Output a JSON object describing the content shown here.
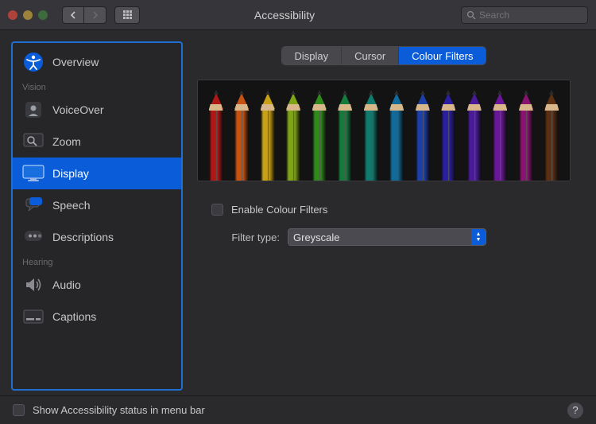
{
  "window": {
    "title": "Accessibility",
    "search_placeholder": "Search"
  },
  "sidebar": {
    "sections": [
      {
        "label": "",
        "items": [
          {
            "id": "overview",
            "label": "Overview",
            "icon": "accessibility-icon",
            "selected": false
          }
        ]
      },
      {
        "label": "Vision",
        "items": [
          {
            "id": "voiceover",
            "label": "VoiceOver",
            "icon": "voiceover-icon",
            "selected": false
          },
          {
            "id": "zoom",
            "label": "Zoom",
            "icon": "zoom-icon",
            "selected": false
          },
          {
            "id": "display",
            "label": "Display",
            "icon": "display-icon",
            "selected": true
          },
          {
            "id": "speech",
            "label": "Speech",
            "icon": "speech-icon",
            "selected": false
          },
          {
            "id": "descriptions",
            "label": "Descriptions",
            "icon": "descriptions-icon",
            "selected": false
          }
        ]
      },
      {
        "label": "Hearing",
        "items": [
          {
            "id": "audio",
            "label": "Audio",
            "icon": "audio-icon",
            "selected": false
          },
          {
            "id": "captions",
            "label": "Captions",
            "icon": "captions-icon",
            "selected": false
          }
        ]
      }
    ]
  },
  "tabs": [
    {
      "id": "display",
      "label": "Display",
      "active": false
    },
    {
      "id": "cursor",
      "label": "Cursor",
      "active": false
    },
    {
      "id": "colour-filters",
      "label": "Colour Filters",
      "active": true
    }
  ],
  "pencils": {
    "colors": [
      "#b01717",
      "#c65312",
      "#c8a014",
      "#7ea515",
      "#2f8a1a",
      "#167a3d",
      "#0f7a6e",
      "#106a9a",
      "#1c3fa8",
      "#2a1fa0",
      "#4a1a9a",
      "#6b169a",
      "#8a1370",
      "#5a2f12"
    ]
  },
  "controls": {
    "enable_label": "Enable Colour Filters",
    "enable_checked": false,
    "filter_type_label": "Filter type:",
    "filter_type_value": "Greyscale"
  },
  "footer": {
    "show_status_label": "Show Accessibility status in menu bar",
    "show_status_checked": false
  }
}
